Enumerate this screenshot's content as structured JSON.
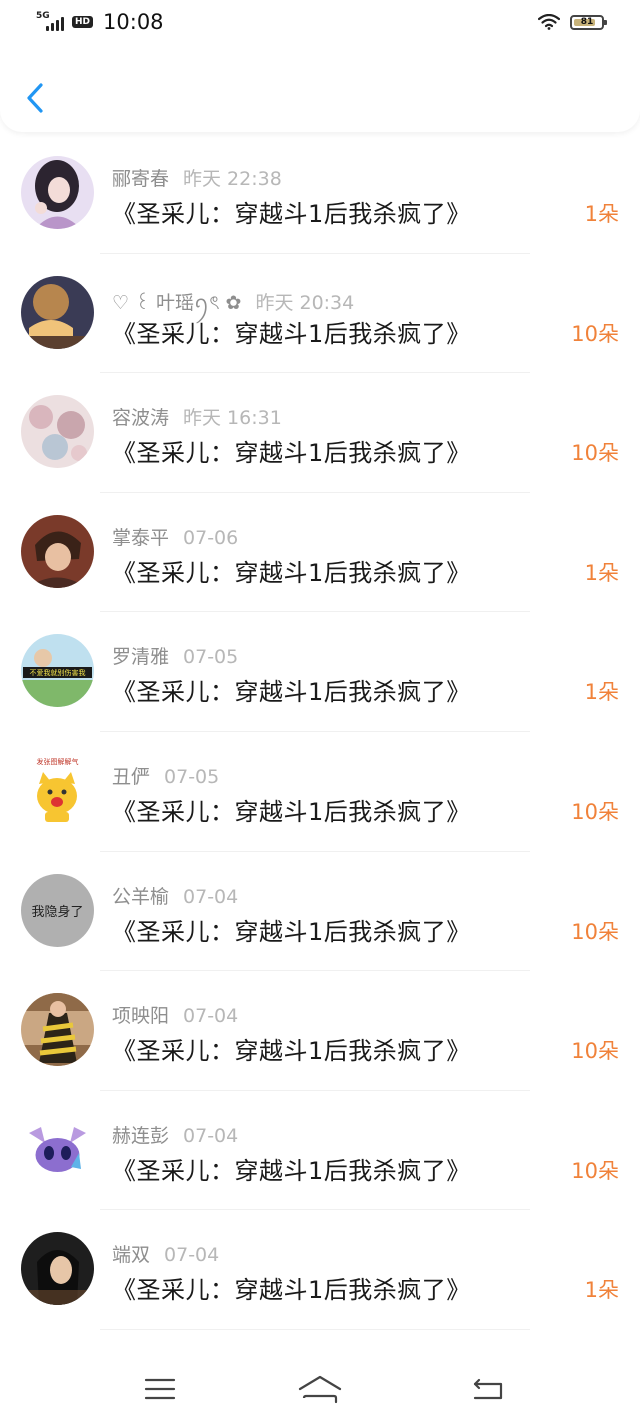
{
  "statusbar": {
    "network": "5G",
    "hd": "HD",
    "time": "10:08",
    "battery": "81",
    "battery_level": 0.81
  },
  "header": {
    "back_icon": "chevron-left-icon",
    "accent": "#2196f3"
  },
  "rows": [
    {
      "name": "郦寄春",
      "date": "昨天 22:38",
      "title": "《圣采儿：穿越斗1后我杀疯了》",
      "count": "1朵"
    },
    {
      "name": "♡ ꒰ 叶瑶ꪆৎ ✿",
      "date": "昨天 20:34",
      "title": "《圣采儿：穿越斗1后我杀疯了》",
      "count": "10朵"
    },
    {
      "name": "容波涛",
      "date": "昨天 16:31",
      "title": "《圣采儿：穿越斗1后我杀疯了》",
      "count": "10朵"
    },
    {
      "name": "掌泰平",
      "date": "07-06",
      "title": "《圣采儿：穿越斗1后我杀疯了》",
      "count": "1朵"
    },
    {
      "name": "罗清雅",
      "date": "07-05",
      "title": "《圣采儿：穿越斗1后我杀疯了》",
      "count": "1朵"
    },
    {
      "name": "丑俨",
      "date": "07-05",
      "title": "《圣采儿：穿越斗1后我杀疯了》",
      "count": "10朵"
    },
    {
      "name": "公羊榆",
      "date": "07-04",
      "title": "《圣采儿：穿越斗1后我杀疯了》",
      "count": "10朵"
    },
    {
      "name": "项映阳",
      "date": "07-04",
      "title": "《圣采儿：穿越斗1后我杀疯了》",
      "count": "10朵"
    },
    {
      "name": "赫连彭",
      "date": "07-04",
      "title": "《圣采儿：穿越斗1后我杀疯了》",
      "count": "10朵"
    },
    {
      "name": "端双",
      "date": "07-04",
      "title": "《圣采儿：穿越斗1后我杀疯了》",
      "count": "1朵"
    }
  ],
  "avatar_texts": {
    "row5": "不爱我就别伤害我",
    "row6": "发张图解解气",
    "row7": "我隐身了"
  },
  "navbar": {
    "menu_icon": "menu-icon",
    "home_icon": "home-icon",
    "back_icon": "back-icon"
  },
  "colors": {
    "count": "#f0823a",
    "name": "#8e8e8e",
    "date": "#b7b7b7"
  }
}
